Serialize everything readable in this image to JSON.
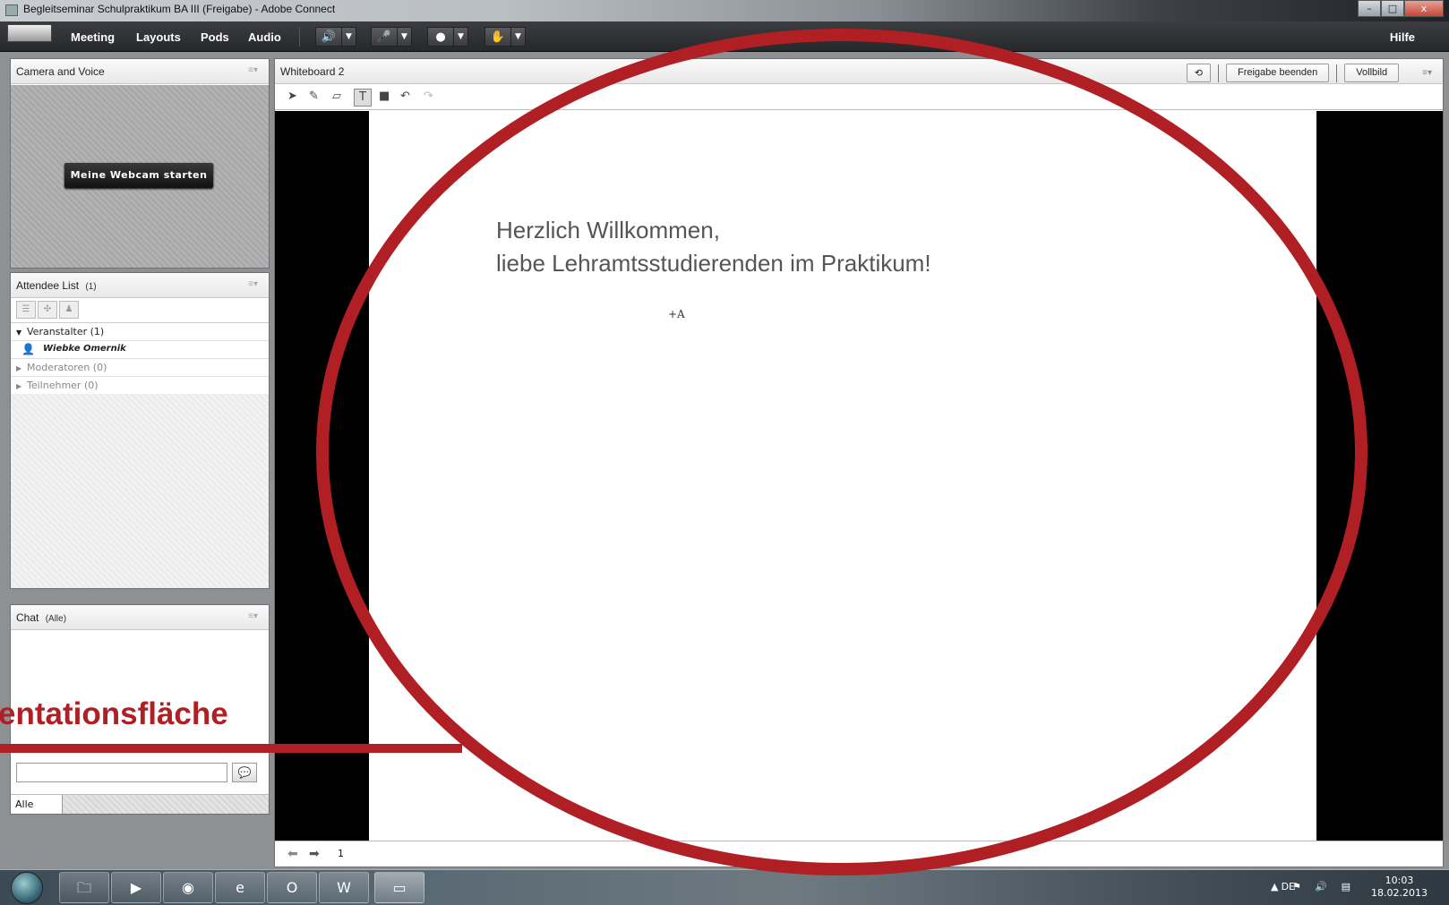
{
  "window": {
    "title": "Begleitseminar Schulpraktikum BA III (Freigabe) - Adobe Connect",
    "controls": [
      "–",
      "□",
      "x"
    ]
  },
  "menubar": {
    "items": [
      "Meeting",
      "Layouts",
      "Pods",
      "Audio"
    ],
    "help": "Hilfe",
    "toolbar_icons": [
      "speaker-icon",
      "microphone-icon",
      "webcam-icon",
      "raise-hand-icon"
    ]
  },
  "camera_pod": {
    "title": "Camera and Voice",
    "start_webcam": "Meine Webcam starten"
  },
  "attendee_pod": {
    "title": "Attendee List",
    "count": "(1)",
    "groups": [
      {
        "label": "Veranstalter (1)",
        "expanded": true
      },
      {
        "label": "Moderatoren (0)",
        "expanded": false
      },
      {
        "label": "Teilnehmer (0)",
        "expanded": false
      }
    ],
    "host": "Wiebke Omernik"
  },
  "chat_pod": {
    "title": "Chat",
    "scope": "(Alle)",
    "input_placeholder": "",
    "recipient": "Alle"
  },
  "whiteboard_pod": {
    "title": "Whiteboard 2",
    "stop_sharing": "Freigabe beenden",
    "fullscreen": "Vollbild",
    "slide_line1": "Herzlich Willkommen,",
    "slide_line2": "liebe Lehramtsstudierenden im Praktikum!",
    "cursor_glyph": "+A",
    "page": "1",
    "tools": [
      "pointer-icon",
      "pencil-icon",
      "eraser-icon",
      "text-tool-icon",
      "shape-icon",
      "undo-icon",
      "redo-icon"
    ]
  },
  "annotation": {
    "label": "entationsfläche",
    "color": "#b01f23"
  },
  "taskbar": {
    "language": "DE",
    "time": "10:03",
    "date": "18.02.2013"
  }
}
